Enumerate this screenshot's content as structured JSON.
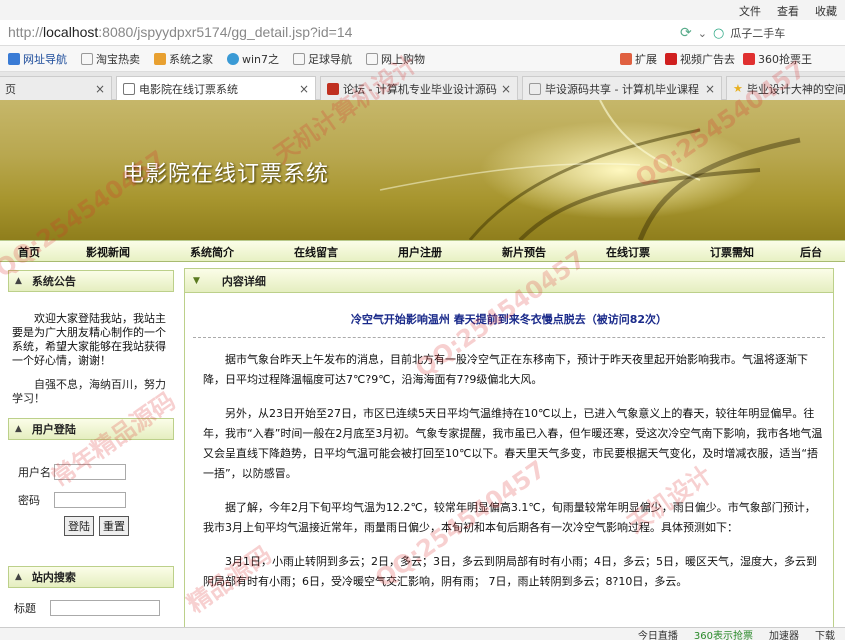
{
  "browser": {
    "menu": [
      "文件",
      "查看",
      "收藏"
    ],
    "url_prefix": "http://",
    "url_host": "localhost",
    "url_rest": ":8080/jspyydpxr5174/gg_detail.jsp?id=14",
    "search_text": "瓜子二手车",
    "bookmarks": [
      "网址导航",
      "淘宝热卖",
      "系统之家",
      "win7之",
      "足球导航",
      "网上购物"
    ],
    "bookmarks_right": [
      "扩展",
      "视频广告去",
      "360抢票王"
    ],
    "tabs": [
      {
        "label": "页"
      },
      {
        "label": "电影院在线订票系统"
      },
      {
        "label": "论坛 - 计算机专业毕业设计源码"
      },
      {
        "label": "毕设源码共享 - 计算机毕业课程"
      },
      {
        "label": "毕业设计大神的空间"
      }
    ],
    "status": [
      "今日直播",
      "360表示抢票",
      "加速器",
      "下载"
    ]
  },
  "site": {
    "title": "电影院在线订票系统",
    "nav": [
      "首页",
      "影视新闻",
      "系统简介",
      "在线留言",
      "用户注册",
      "新片预告",
      "在线订票",
      "订票需知",
      "后台"
    ]
  },
  "sidebar": {
    "notice_title": "系统公告",
    "notice_text": "欢迎大家登陆我站，我站主要是为广大朋友精心制作的一个系统，希望大家能够在我站获得一个好心情，谢谢！",
    "notice_text2": "自强不息，海纳百川，努力学习！",
    "login_title": "用户登陆",
    "username_label": "用户名",
    "password_label": "密码",
    "login_btn": "登陆",
    "reset_btn": "重置",
    "search_title": "站内搜索",
    "search_label": "标题"
  },
  "main": {
    "header": "内容详细",
    "title": "冷空气开始影响温州 春天提前到来冬衣慢点脱去（被访问82次）",
    "paragraphs": [
      "据市气象台昨天上午发布的消息，目前北方有一股冷空气正在东移南下，预计于昨天夜里起开始影响我市。气温将逐渐下降，日平均过程降温幅度可达7℃?9℃，沿海海面有7?9级偏北大风。",
      "另外，从23日开始至27日，市区已连续5天日平均气温维持在10℃以上，已进入气象意义上的春天，较往年明显偏早。往年，我市“入春”时间一般在2月底至3月初。气象专家提醒，我市虽已入春，但乍暖还寒，受这次冷空气南下影响，我市各地气温又会呈直线下降趋势，日平均气温可能会被打回至10℃以下。春天里天气多变，市民要根据天气变化，及时增减衣服，适当“捂一捂”，以防感冒。",
      "据了解，今年2月下旬平均气温为12.2℃，较常年明显偏高3.1℃，旬雨量较常年明显偏少，雨日偏少。市气象部门预计，我市3月上旬平均气温接近常年，雨量雨日偏少，本旬初和本旬后期各有一次冷空气影响过程。具体预测如下：",
      "3月1日，小雨止转阴到多云；2日，多云；3日，多云到阴局部有时有小雨；4日，多云；5日，暖区天气，湿度大，多云到阴局部有时有小雨；6日，受冷暖空气交汇影响，阴有雨； 7日，雨止转阴到多云；8?10日，多云。"
    ]
  },
  "watermarks": [
    "QQ:254540457",
    "天机计算机设计",
    "常年精品源码",
    "QQ:254540457",
    "天机设计",
    "QQ:254540457",
    "精品源码",
    "QQ:254540457"
  ]
}
